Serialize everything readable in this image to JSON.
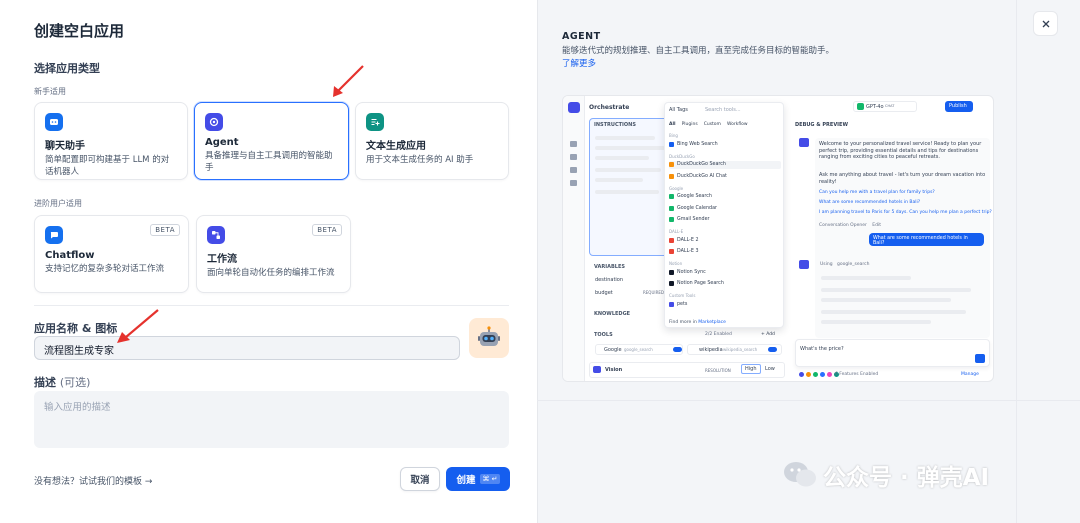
{
  "dialog": {
    "title": "创建空白应用",
    "app_type_label": "选择应用类型",
    "beginner_label": "新手适用",
    "advanced_label": "进阶用户适用",
    "name_label": "应用名称 & 图标",
    "name_value": "流程图生成专家",
    "desc_label": "描述",
    "desc_optional": "(可选)",
    "desc_placeholder": "输入应用的描述",
    "template_hint": "没有想法？试试我们的模板 →",
    "cancel": "取消",
    "create": "创建",
    "create_kbd": "⌘ ↵"
  },
  "cards": {
    "chat": {
      "name": "聊天助手",
      "desc": "简单配置即可构建基于 LLM 的对话机器人",
      "color": "#1570ef"
    },
    "agent": {
      "name": "Agent",
      "desc": "具备推理与自主工具调用的智能助手",
      "color": "#444ce7"
    },
    "textgen": {
      "name": "文本生成应用",
      "desc": "用于文本生成任务的 AI 助手",
      "color": "#0e9384"
    },
    "chatflow": {
      "name": "Chatflow",
      "desc": "支持记忆的复杂多轮对话工作流",
      "badge": "BETA",
      "color": "#1570ef"
    },
    "workflow": {
      "name": "工作流",
      "desc": "面向单轮自动化任务的编排工作流",
      "badge": "BETA",
      "color": "#444ce7"
    }
  },
  "info": {
    "title": "AGENT",
    "desc": "能够迭代式的规划推理、自主工具调用，直至完成任务目标的智能助手。",
    "link": "了解更多"
  },
  "preview": {
    "orchestrate": "Orchestrate",
    "instructions": "INSTRUCTIONS",
    "variables": "VARIABLES",
    "var1": "destination",
    "var2": "budget",
    "var2_tag": "REQUIRED",
    "knowledge": "KNOWLEDGE",
    "tools": "TOOLS",
    "tools_enabled": "2/2 Enabled",
    "tools_add": "+ Add",
    "tool1": "Google",
    "tool1_sub": "google_search",
    "tool2": "wikipedia",
    "tool2_sub": "wikipedia_search",
    "vision": "Vision",
    "resolution": "RESOLUTION",
    "res_high": "High",
    "res_low": "Low",
    "dropdown_filter": "All Tags",
    "dropdown_search": "Search tools...",
    "tabs": [
      "All",
      "Plugins",
      "Custom",
      "Workflow"
    ],
    "groups": [
      {
        "name": "Bing",
        "items": [
          "Bing Web Search"
        ]
      },
      {
        "name": "DuckDuckGo",
        "items": [
          "DuckDuckGo Search",
          "DuckDuckGo AI Chat"
        ]
      },
      {
        "name": "Google",
        "items": [
          "Google Search",
          "Google Calendar",
          "Gmail Sender"
        ]
      },
      {
        "name": "DALL-E",
        "items": [
          "DALL-E 2",
          "DALL-E 3"
        ]
      },
      {
        "name": "Notion",
        "items": [
          "Notion Sync",
          "Notion Page Search"
        ]
      },
      {
        "name": "Custom Tools",
        "items": [
          "pets"
        ]
      }
    ],
    "find_more": "Find more in",
    "marketplace": "Marketplace",
    "model": "GPT-4o",
    "model_tag": "CHAT",
    "publish": "Publish",
    "debug": "DEBUG & PREVIEW",
    "bot_msg1": "Welcome to your personalized travel service! Ready to plan your perfect trip, providing essential details and tips for destinations ranging from exciting cities to peaceful retreats.",
    "bot_msg2": "Ask me anything about travel - let's turn your dream vacation into reality!",
    "suggest1": "Can you help me with a travel plan for family trips?",
    "suggest2": "What are some recommended hotels in Bali?",
    "suggest3": "I am planning travel to Paris for 5 days. Can you help me plan a perfect trip?",
    "opener": "Conversation Opener",
    "opener_edit": "Edit",
    "user_msg": "What are some recommended hotels in Bali?",
    "using": "Using",
    "using_tool": "google_search",
    "input_text": "What's the price?",
    "features": "6 Features Enabled",
    "manage": "Manage"
  },
  "watermark": "公众号 · 弹壳AI",
  "icons": {
    "close": "close-icon",
    "robot": "robot-avatar-icon"
  }
}
